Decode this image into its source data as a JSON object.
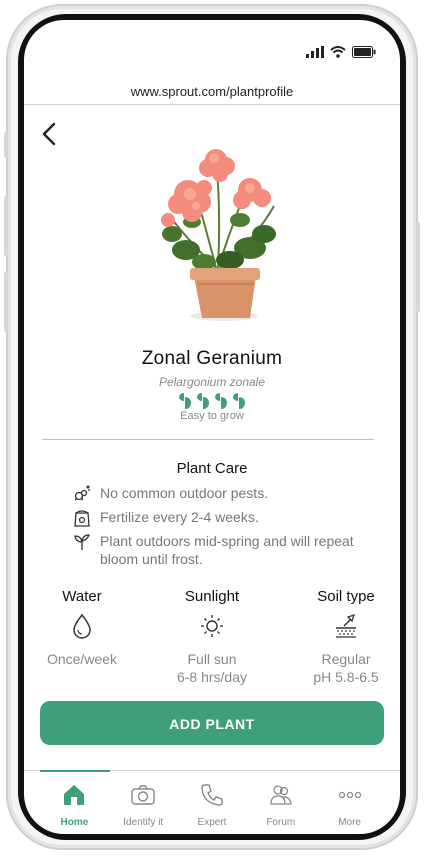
{
  "browser": {
    "url": "www.sprout.com/plantprofile"
  },
  "plant": {
    "name": "Zonal Geranium",
    "scientific_name": "Pelargonium zonale",
    "difficulty_rating": 4,
    "difficulty_max": 4,
    "difficulty_label": "Easy to grow"
  },
  "care": {
    "title": "Plant Care",
    "items": [
      {
        "icon": "pest-icon",
        "text": "No common outdoor pests."
      },
      {
        "icon": "fertilizer-bag-icon",
        "text": "Fertilize every 2-4 weeks."
      },
      {
        "icon": "sprout-icon",
        "text": "Plant outdoors mid-spring and will repeat bloom until frost."
      }
    ]
  },
  "stats": {
    "water": {
      "label": "Water",
      "icon": "water-drop-icon",
      "value_line1": "Once/week",
      "value_line2": ""
    },
    "sunlight": {
      "label": "Sunlight",
      "icon": "sun-icon",
      "value_line1": "Full sun",
      "value_line2": "6-8 hrs/day"
    },
    "soil": {
      "label": "Soil type",
      "icon": "soil-trowel-icon",
      "value_line1": "Regular",
      "value_line2": "pH 5.8-6.5"
    }
  },
  "actions": {
    "add_plant_label": "ADD PLANT"
  },
  "tabs": [
    {
      "id": "home",
      "label": "Home",
      "icon": "home-icon",
      "active": true
    },
    {
      "id": "identify",
      "label": "Identify it",
      "icon": "camera-icon",
      "active": false
    },
    {
      "id": "expert",
      "label": "Expert",
      "icon": "phone-icon",
      "active": false
    },
    {
      "id": "forum",
      "label": "Forum",
      "icon": "people-icon",
      "active": false
    },
    {
      "id": "more",
      "label": "More",
      "icon": "more-dots-icon",
      "active": false
    }
  ],
  "colors": {
    "accent": "#3f9f7a",
    "muted_text": "#888888"
  }
}
